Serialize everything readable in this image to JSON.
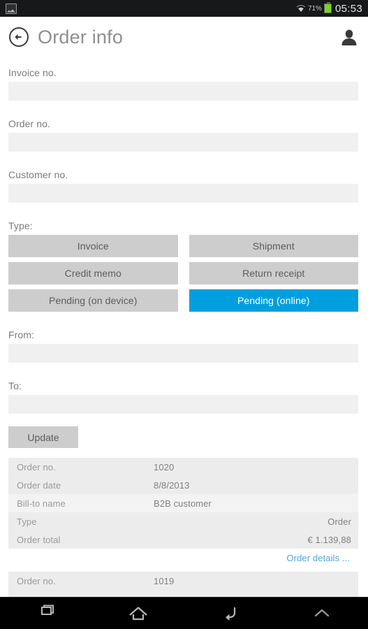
{
  "statusbar": {
    "notification_icon": "image-screenshot-icon",
    "wifi_icon": "wifi-icon",
    "battery_percent": "71%",
    "battery_icon": "battery-icon",
    "battery_color": "#7ed321",
    "clock": "05:53"
  },
  "appbar": {
    "back_icon": "back-circle-arrow-icon",
    "title": "Order info",
    "avatar_icon": "user-person-icon"
  },
  "form": {
    "invoice_no": {
      "label": "Invoice no.",
      "value": "",
      "placeholder": ""
    },
    "order_no": {
      "label": "Order no.",
      "value": "",
      "placeholder": ""
    },
    "customer_no": {
      "label": "Customer no.",
      "value": "",
      "placeholder": ""
    },
    "type": {
      "label": "Type:",
      "selected": "Pending (online)",
      "accent_color": "#019fe0",
      "options": [
        {
          "label": "Invoice",
          "selected": false
        },
        {
          "label": "Shipment",
          "selected": false
        },
        {
          "label": "Credit memo",
          "selected": false
        },
        {
          "label": "Return receipt",
          "selected": false
        },
        {
          "label": "Pending (on device)",
          "selected": false
        },
        {
          "label": "Pending (online)",
          "selected": true
        }
      ]
    },
    "from": {
      "label": "From:",
      "value": "",
      "placeholder": ""
    },
    "to": {
      "label": "To:",
      "value": "",
      "placeholder": ""
    },
    "update_button": "Update"
  },
  "results": {
    "cards": [
      {
        "rows": [
          {
            "label": "Order no.",
            "value": "1020",
            "align": "left"
          },
          {
            "label": "Order date",
            "value": "8/8/2013",
            "align": "left"
          },
          {
            "label": "Bill-to name",
            "value": "B2B customer",
            "align": "left"
          },
          {
            "label": "Type",
            "value": "Order",
            "align": "right"
          },
          {
            "label": "Order total",
            "value": "€ 1.139,88",
            "align": "right"
          }
        ],
        "link": "Order details ...",
        "link_color": "#4da6d9"
      },
      {
        "rows": [
          {
            "label": "Order no.",
            "value": "1019",
            "align": "left"
          }
        ]
      }
    ]
  },
  "navbar": {
    "recents_icon": "recents-squares-icon",
    "home_icon": "home-icon",
    "back_icon": "back-arrow-icon",
    "expand_icon": "chevron-up-icon"
  }
}
